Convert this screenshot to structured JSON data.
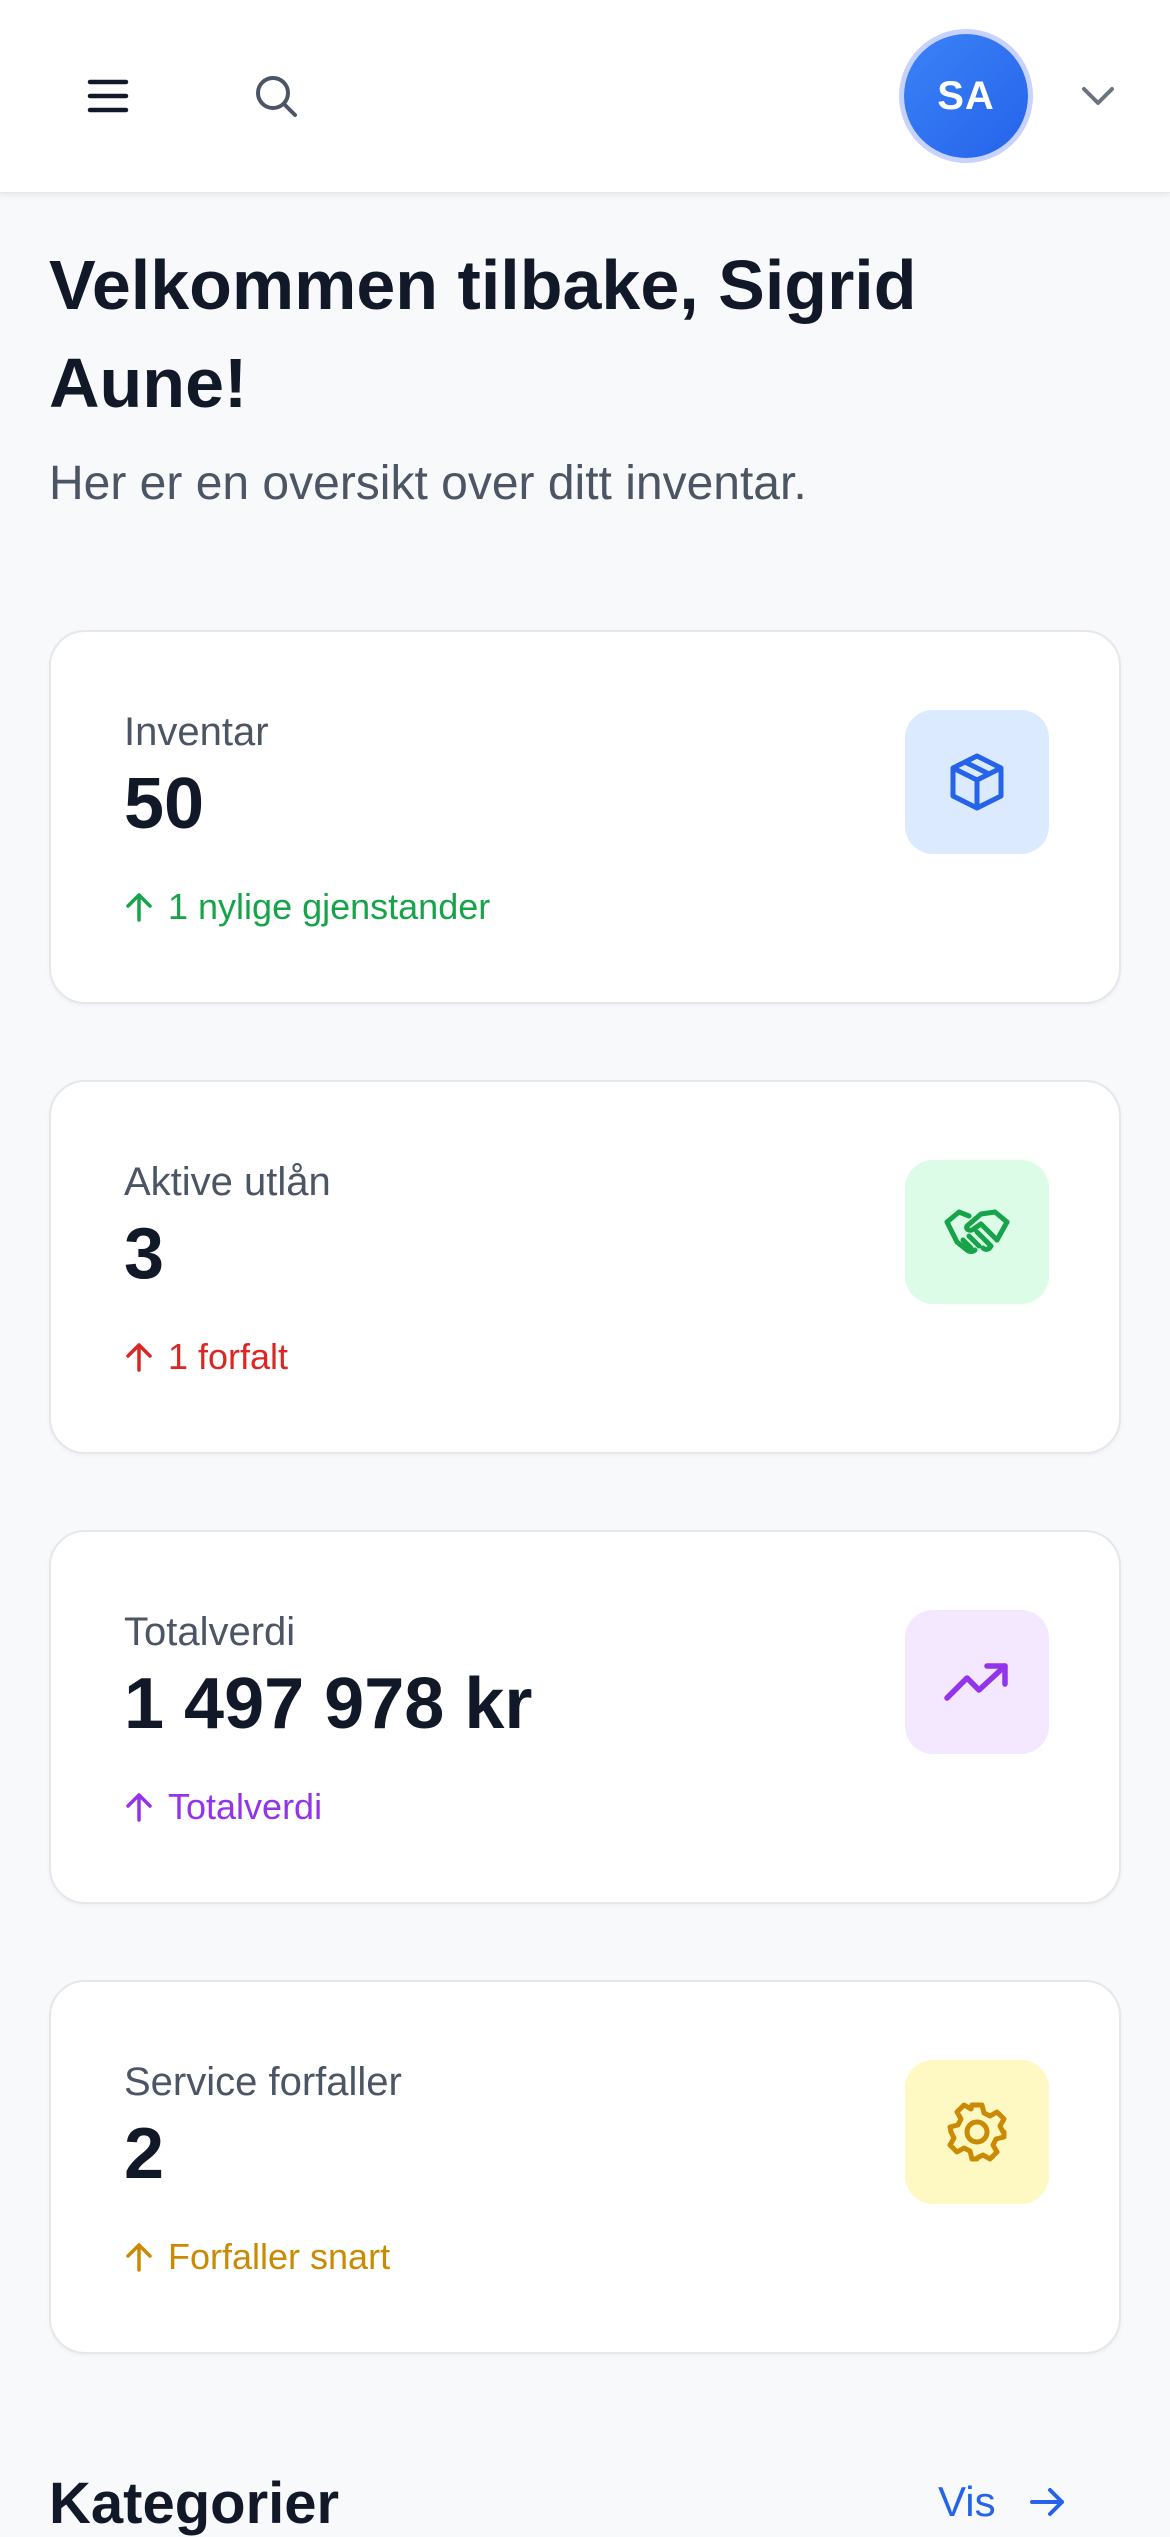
{
  "header": {
    "menu_icon": "menu-icon",
    "search_icon": "search-icon",
    "avatar_initials": "SA",
    "chevron_icon": "chevron-down-icon"
  },
  "welcome": {
    "title": "Velkommen tilbake, Sigrid Aune!",
    "subtitle": "Her er en oversikt over ditt inventar."
  },
  "stats": [
    {
      "label": "Inventar",
      "value": "50",
      "trend": "1 nylige gjenstander",
      "trend_color": "#16a34a",
      "icon": "package-icon",
      "icon_bg": "#dbeafe",
      "icon_color": "#2563eb"
    },
    {
      "label": "Aktive utlån",
      "value": "3",
      "trend": "1 forfalt",
      "trend_color": "#dc2626",
      "icon": "handshake-icon",
      "icon_bg": "#dcfce7",
      "icon_color": "#16a34a"
    },
    {
      "label": "Totalverdi",
      "value": "1 497 978 kr",
      "trend": "Totalverdi",
      "trend_color": "#9333ea",
      "icon": "trending-up-icon",
      "icon_bg": "#f3e8ff",
      "icon_color": "#9333ea"
    },
    {
      "label": "Service forfaller",
      "value": "2",
      "trend": "Forfaller snart",
      "trend_color": "#ca8a04",
      "icon": "gear-icon",
      "icon_bg": "#fef9c3",
      "icon_color": "#ca8a04"
    }
  ],
  "categories": {
    "title": "Kategorier",
    "link_label": "Vis"
  }
}
